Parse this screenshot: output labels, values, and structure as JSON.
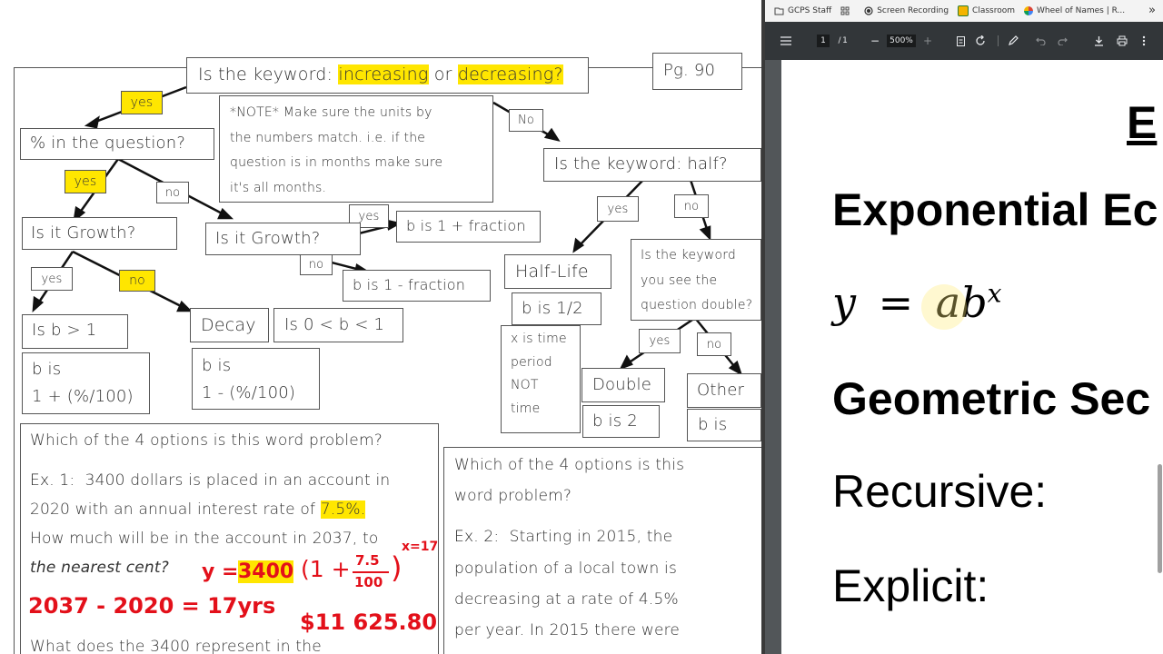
{
  "worksheet": {
    "flowchart": {
      "top_question": "Is the keyword: increasing or decreasing?",
      "top_question_part1": "Is the keyword: ",
      "top_question_increasing": "increasing",
      "top_question_or": " or ",
      "top_question_decreasing": "decreasing",
      "top_question_end": "?",
      "page_ref": "Pg. 90",
      "note": [
        "*NOTE* Make sure the units by",
        "the numbers match. i.e. if the",
        "question is in months make sure",
        "it's all months."
      ],
      "yes": "yes",
      "no": "no",
      "No": "No",
      "percent_question": "% in the question?",
      "growth_q1": "Is it Growth?",
      "growth_q2": "Is it Growth?",
      "b_plus_fraction": "b is 1 + fraction",
      "b_minus_fraction": "b is 1 - fraction",
      "b_gt_1": "Is b > 1",
      "decay": "Decay",
      "b_between": "Is 0 < b < 1",
      "b_is": "b is",
      "b_plus_pct": "1 + (%/100)",
      "b_minus_pct": "1 - (%/100)",
      "half_question": "Is the keyword: half?",
      "half_life": "Half-Life",
      "b_half": "b is 1/2",
      "x_time": [
        "x is time",
        "period",
        "NOT",
        "time"
      ],
      "double_question": [
        "Is the keyword",
        "you see the",
        "question double?"
      ],
      "double": "Double",
      "b_two": "b is 2",
      "other": "Other",
      "b_is_other": "b is"
    },
    "example1": {
      "question": "Which of the 4 options is this word problem?",
      "label": "Ex. 1:",
      "line1": "3400 dollars is placed in an account in",
      "line2a": "2020 with an annual interest rate of ",
      "rate": "7.5%.",
      "line3": "How much will be in the account in 2037, to",
      "line4": "the nearest cent?",
      "line5": "What does the 3400 represent in the"
    },
    "annotations": {
      "formula_y": "y =",
      "formula_a": "3400",
      "formula_paren": "(1 +",
      "formula_num": "7.5",
      "formula_den": "100",
      "formula_close": ")",
      "formula_exp": "x=17",
      "years": "2037 - 2020 = 17yrs",
      "answer": "$11 625.80"
    },
    "example2": {
      "question_l1": "Which of the 4 options is this",
      "question_l2": "word problem?",
      "label": "Ex. 2:",
      "line1": "Starting in 2015, the",
      "line2": "population of a local town is",
      "line3": "decreasing at a rate of 4.5%",
      "line4": "per year. In 2015 there were"
    }
  },
  "browser": {
    "bookmarks": [
      {
        "label": "GCPS Staff",
        "icon": "folder-icon"
      },
      {
        "label": "",
        "icon": "apps-grid-icon"
      },
      {
        "label": "Screen Recording",
        "icon": "record-icon"
      },
      {
        "label": "Classroom",
        "icon": "classroom-icon"
      },
      {
        "label": "Wheel of Names | R...",
        "icon": "wheel-icon"
      }
    ],
    "more": "»"
  },
  "pdf_toolbar": {
    "page_current": "1",
    "page_sep": "/",
    "page_total": "1",
    "zoom": "500%",
    "zoom_out": "−",
    "zoom_in": "+"
  },
  "pdf_page": {
    "heading_fragment": "E",
    "title": "Exponential Ec",
    "formula_y": "y",
    "formula_eq": "=",
    "formula_ab": "ab",
    "formula_x": "x",
    "geometric": "Geometric Sec",
    "recursive": "Recursive:",
    "explicit": "Explicit:"
  },
  "colors": {
    "highlight": "#ffe600",
    "annotation_red": "#e3101a",
    "toolbar": "#323639",
    "pdf_background": "#525659"
  }
}
